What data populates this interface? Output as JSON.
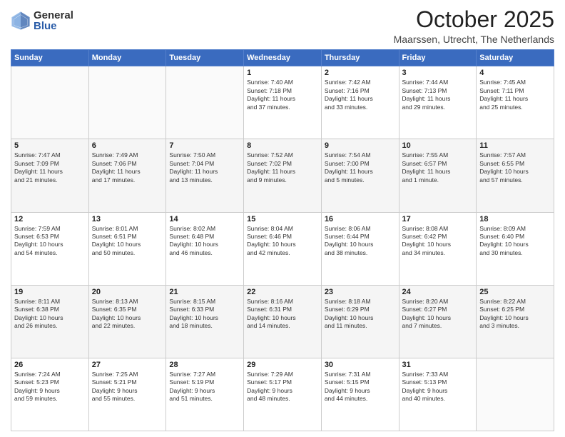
{
  "logo": {
    "general": "General",
    "blue": "Blue"
  },
  "title": "October 2025",
  "location": "Maarssen, Utrecht, The Netherlands",
  "days_of_week": [
    "Sunday",
    "Monday",
    "Tuesday",
    "Wednesday",
    "Thursday",
    "Friday",
    "Saturday"
  ],
  "weeks": [
    [
      {
        "day": "",
        "info": ""
      },
      {
        "day": "",
        "info": ""
      },
      {
        "day": "",
        "info": ""
      },
      {
        "day": "1",
        "info": "Sunrise: 7:40 AM\nSunset: 7:18 PM\nDaylight: 11 hours\nand 37 minutes."
      },
      {
        "day": "2",
        "info": "Sunrise: 7:42 AM\nSunset: 7:16 PM\nDaylight: 11 hours\nand 33 minutes."
      },
      {
        "day": "3",
        "info": "Sunrise: 7:44 AM\nSunset: 7:13 PM\nDaylight: 11 hours\nand 29 minutes."
      },
      {
        "day": "4",
        "info": "Sunrise: 7:45 AM\nSunset: 7:11 PM\nDaylight: 11 hours\nand 25 minutes."
      }
    ],
    [
      {
        "day": "5",
        "info": "Sunrise: 7:47 AM\nSunset: 7:09 PM\nDaylight: 11 hours\nand 21 minutes."
      },
      {
        "day": "6",
        "info": "Sunrise: 7:49 AM\nSunset: 7:06 PM\nDaylight: 11 hours\nand 17 minutes."
      },
      {
        "day": "7",
        "info": "Sunrise: 7:50 AM\nSunset: 7:04 PM\nDaylight: 11 hours\nand 13 minutes."
      },
      {
        "day": "8",
        "info": "Sunrise: 7:52 AM\nSunset: 7:02 PM\nDaylight: 11 hours\nand 9 minutes."
      },
      {
        "day": "9",
        "info": "Sunrise: 7:54 AM\nSunset: 7:00 PM\nDaylight: 11 hours\nand 5 minutes."
      },
      {
        "day": "10",
        "info": "Sunrise: 7:55 AM\nSunset: 6:57 PM\nDaylight: 11 hours\nand 1 minute."
      },
      {
        "day": "11",
        "info": "Sunrise: 7:57 AM\nSunset: 6:55 PM\nDaylight: 10 hours\nand 57 minutes."
      }
    ],
    [
      {
        "day": "12",
        "info": "Sunrise: 7:59 AM\nSunset: 6:53 PM\nDaylight: 10 hours\nand 54 minutes."
      },
      {
        "day": "13",
        "info": "Sunrise: 8:01 AM\nSunset: 6:51 PM\nDaylight: 10 hours\nand 50 minutes."
      },
      {
        "day": "14",
        "info": "Sunrise: 8:02 AM\nSunset: 6:48 PM\nDaylight: 10 hours\nand 46 minutes."
      },
      {
        "day": "15",
        "info": "Sunrise: 8:04 AM\nSunset: 6:46 PM\nDaylight: 10 hours\nand 42 minutes."
      },
      {
        "day": "16",
        "info": "Sunrise: 8:06 AM\nSunset: 6:44 PM\nDaylight: 10 hours\nand 38 minutes."
      },
      {
        "day": "17",
        "info": "Sunrise: 8:08 AM\nSunset: 6:42 PM\nDaylight: 10 hours\nand 34 minutes."
      },
      {
        "day": "18",
        "info": "Sunrise: 8:09 AM\nSunset: 6:40 PM\nDaylight: 10 hours\nand 30 minutes."
      }
    ],
    [
      {
        "day": "19",
        "info": "Sunrise: 8:11 AM\nSunset: 6:38 PM\nDaylight: 10 hours\nand 26 minutes."
      },
      {
        "day": "20",
        "info": "Sunrise: 8:13 AM\nSunset: 6:35 PM\nDaylight: 10 hours\nand 22 minutes."
      },
      {
        "day": "21",
        "info": "Sunrise: 8:15 AM\nSunset: 6:33 PM\nDaylight: 10 hours\nand 18 minutes."
      },
      {
        "day": "22",
        "info": "Sunrise: 8:16 AM\nSunset: 6:31 PM\nDaylight: 10 hours\nand 14 minutes."
      },
      {
        "day": "23",
        "info": "Sunrise: 8:18 AM\nSunset: 6:29 PM\nDaylight: 10 hours\nand 11 minutes."
      },
      {
        "day": "24",
        "info": "Sunrise: 8:20 AM\nSunset: 6:27 PM\nDaylight: 10 hours\nand 7 minutes."
      },
      {
        "day": "25",
        "info": "Sunrise: 8:22 AM\nSunset: 6:25 PM\nDaylight: 10 hours\nand 3 minutes."
      }
    ],
    [
      {
        "day": "26",
        "info": "Sunrise: 7:24 AM\nSunset: 5:23 PM\nDaylight: 9 hours\nand 59 minutes."
      },
      {
        "day": "27",
        "info": "Sunrise: 7:25 AM\nSunset: 5:21 PM\nDaylight: 9 hours\nand 55 minutes."
      },
      {
        "day": "28",
        "info": "Sunrise: 7:27 AM\nSunset: 5:19 PM\nDaylight: 9 hours\nand 51 minutes."
      },
      {
        "day": "29",
        "info": "Sunrise: 7:29 AM\nSunset: 5:17 PM\nDaylight: 9 hours\nand 48 minutes."
      },
      {
        "day": "30",
        "info": "Sunrise: 7:31 AM\nSunset: 5:15 PM\nDaylight: 9 hours\nand 44 minutes."
      },
      {
        "day": "31",
        "info": "Sunrise: 7:33 AM\nSunset: 5:13 PM\nDaylight: 9 hours\nand 40 minutes."
      },
      {
        "day": "",
        "info": ""
      }
    ]
  ]
}
